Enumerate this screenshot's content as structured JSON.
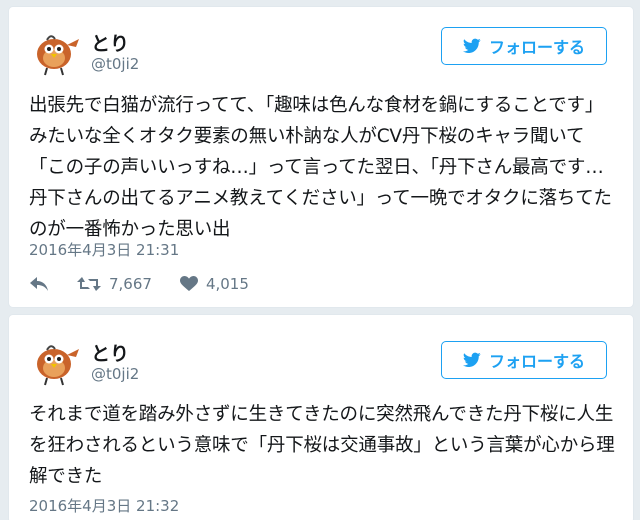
{
  "tweets": [
    {
      "name": "とり",
      "handle": "@t0ji2",
      "follow_label": "フォローする",
      "text": "出張先で白猫が流行ってて、「趣味は色んな食材を鍋にすることです」みたいな全くオタク要素の無い朴訥な人がCV丹下桜のキャラ聞いて「この子の声いいっすね…」って言ってた翌日、「丹下さん最高です…丹下さんの出てるアニメ教えてください」って一晩でオタクに落ちてたのが一番怖かった思い出",
      "date": "2016年4月3日 21:31",
      "retweets": "7,667",
      "likes": "4,015"
    },
    {
      "name": "とり",
      "handle": "@t0ji2",
      "follow_label": "フォローする",
      "text": "それまで道を踏み外さずに生きてきたのに突然飛んできた丹下桜に人生を狂わされるという意味で「丹下桜は交通事故」という言葉が心から理解できた",
      "date": "2016年4月3日 21:32"
    }
  ],
  "colors": {
    "accent": "#1da1f2",
    "muted": "#657786",
    "background": "#e6ecf0"
  },
  "icons": [
    "bird-avatar-icon",
    "twitter-bird-icon",
    "reply-icon",
    "retweet-icon",
    "heart-icon"
  ]
}
